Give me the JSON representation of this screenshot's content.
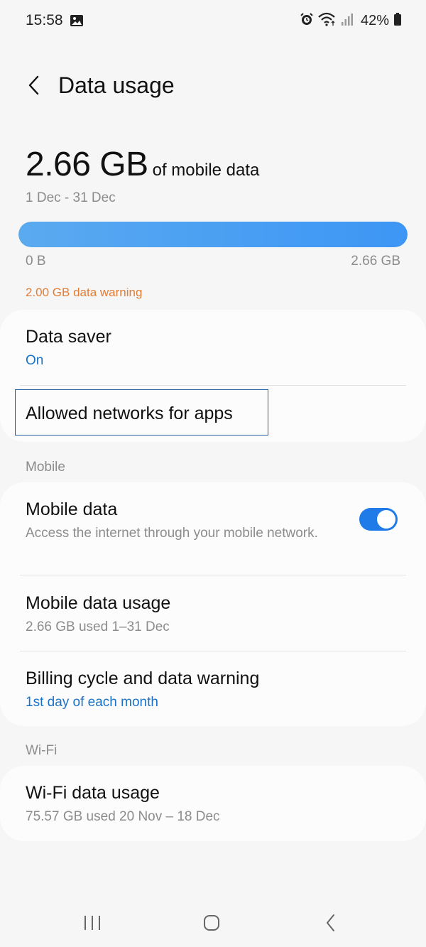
{
  "status_bar": {
    "time": "15:58",
    "battery_percent": "42%",
    "icons": [
      "gallery-icon",
      "alarm-icon",
      "wifi-icon",
      "signal-icon",
      "battery-icon"
    ]
  },
  "header": {
    "title": "Data usage",
    "back_icon": "chevron-left-icon"
  },
  "usage": {
    "amount": "2.66 GB",
    "suffix": "of mobile data",
    "period": "1 Dec - 31 Dec",
    "bar_fill_fraction": 1.0,
    "bar_min": "0 B",
    "bar_max": "2.66 GB",
    "warning": "2.00 GB data warning"
  },
  "card1": {
    "data_saver": {
      "title": "Data saver",
      "status": "On"
    },
    "allowed_networks": {
      "title": "Allowed networks for apps"
    }
  },
  "sections": {
    "mobile": "Mobile",
    "wifi": "Wi-Fi"
  },
  "mobile_card": {
    "mobile_data": {
      "title": "Mobile data",
      "description": "Access the internet through your mobile network.",
      "enabled": true
    },
    "mobile_data_usage": {
      "title": "Mobile data usage",
      "sub": "2.66 GB used 1–31 Dec"
    },
    "billing": {
      "title": "Billing cycle and data warning",
      "sub": "1st day of each month"
    }
  },
  "wifi_card": {
    "wifi_usage": {
      "title": "Wi-Fi data usage",
      "sub": "75.57 GB used 20 Nov – 18 Dec"
    }
  },
  "nav_bar": {
    "icons": [
      "recents-icon",
      "home-icon",
      "back-icon"
    ]
  },
  "colors": {
    "accent_blue": "#1a73c8",
    "toggle_blue": "#1f7be8",
    "warning_orange": "#e17d35",
    "bar_blue": "#3d96f5"
  }
}
